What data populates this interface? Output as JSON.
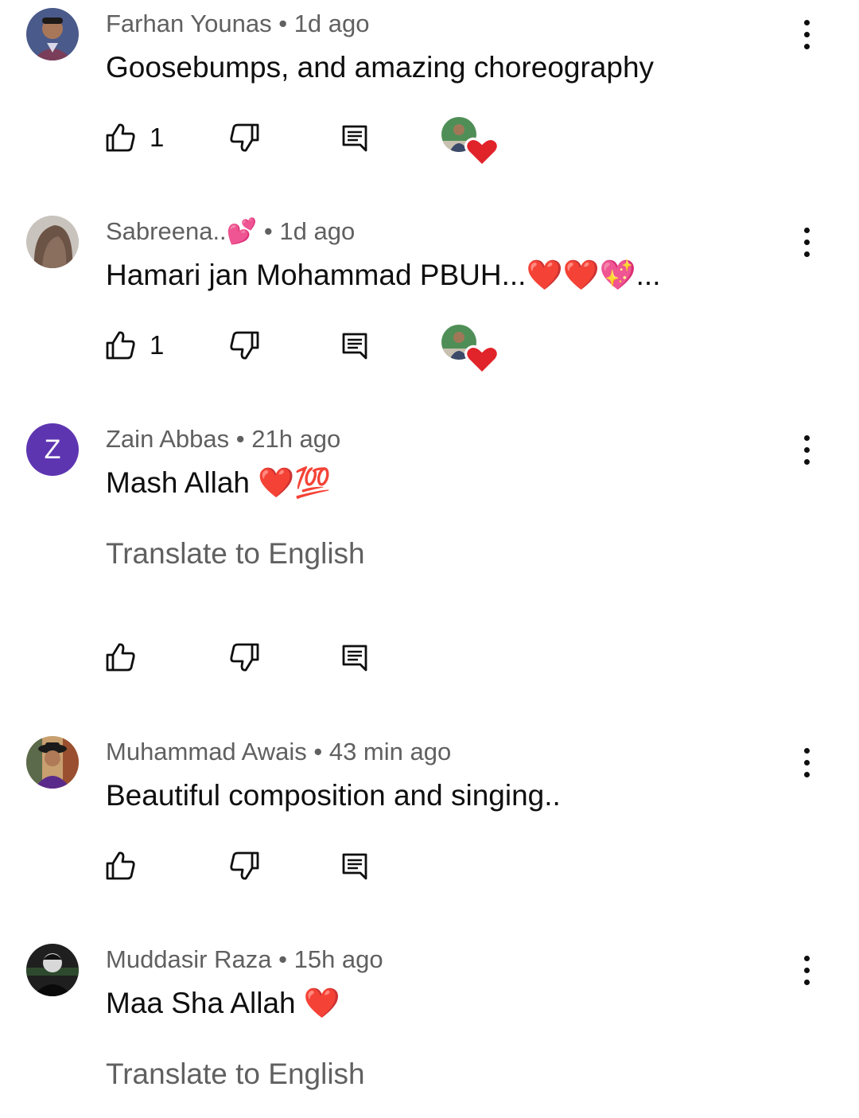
{
  "comments": [
    {
      "author": "Farhan Younas",
      "time": "1d ago",
      "text": "Goosebumps, and amazing choreography",
      "likes": "1",
      "avatar_icon": "user-photo-icon",
      "creator_hearted": true
    },
    {
      "author": "Sabreena..💕",
      "time": "1d ago",
      "text": "Hamari jan Mohammad PBUH...❤️❤️💖...",
      "likes": "1",
      "avatar_icon": "user-photo-icon",
      "creator_hearted": true
    },
    {
      "author": "Zain Abbas",
      "time": "21h ago",
      "text": "Mash Allah ❤️💯",
      "avatar_letter": "Z",
      "avatar_color": "#5e35b1",
      "translate": "Translate to English",
      "creator_hearted": false
    },
    {
      "author": "Muhammad Awais",
      "time": "43 min ago",
      "text": "Beautiful composition and singing..",
      "avatar_icon": "user-photo-icon",
      "creator_hearted": false
    },
    {
      "author": "Muddasir Raza",
      "time": "15h ago",
      "text": "Maa Sha Allah ❤️",
      "avatar_icon": "user-photo-icon",
      "translate": "Translate to English",
      "creator_hearted": false
    }
  ],
  "separator": "•",
  "colors": {
    "primary_text": "#0f0f0f",
    "secondary_text": "#606060",
    "heart": "#e0242a",
    "avatar_letter_bg": "#5e35b1"
  }
}
